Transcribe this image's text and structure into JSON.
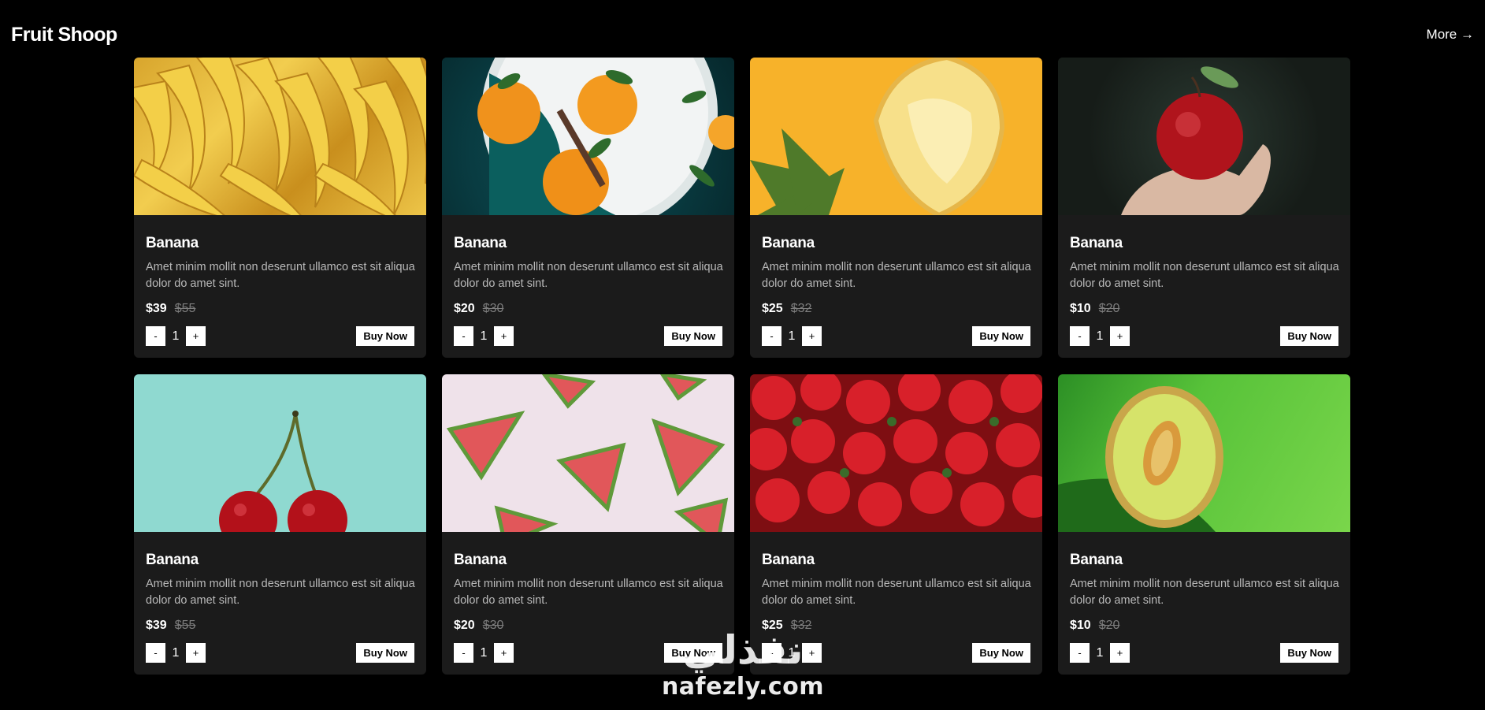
{
  "header": {
    "brand": "Fruit Shoop",
    "more_label": "More →"
  },
  "products": [
    {
      "image": "bananas",
      "title": "Banana",
      "description": "Amet minim mollit non deserunt ullamco est sit aliqua dolor do amet sint.",
      "price": "$39",
      "old_price": "$55",
      "quantity": "1",
      "minus": "-",
      "plus": "+",
      "buy_label": "Buy Now"
    },
    {
      "image": "oranges",
      "title": "Banana",
      "description": "Amet minim mollit non deserunt ullamco est sit aliqua dolor do amet sint.",
      "price": "$20",
      "old_price": "$30",
      "quantity": "1",
      "minus": "-",
      "plus": "+",
      "buy_label": "Buy Now"
    },
    {
      "image": "pineapple",
      "title": "Banana",
      "description": "Amet minim mollit non deserunt ullamco est sit aliqua dolor do amet sint.",
      "price": "$25",
      "old_price": "$32",
      "quantity": "1",
      "minus": "-",
      "plus": "+",
      "buy_label": "Buy Now"
    },
    {
      "image": "apple",
      "title": "Banana",
      "description": "Amet minim mollit non deserunt ullamco est sit aliqua dolor do amet sint.",
      "price": "$10",
      "old_price": "$20",
      "quantity": "1",
      "minus": "-",
      "plus": "+",
      "buy_label": "Buy Now"
    },
    {
      "image": "cherries",
      "title": "Banana",
      "description": "Amet minim mollit non deserunt ullamco est sit aliqua dolor do amet sint.",
      "price": "$39",
      "old_price": "$55",
      "quantity": "1",
      "minus": "-",
      "plus": "+",
      "buy_label": "Buy Now"
    },
    {
      "image": "watermelon",
      "title": "Banana",
      "description": "Amet minim mollit non deserunt ullamco est sit aliqua dolor do amet sint.",
      "price": "$20",
      "old_price": "$30",
      "quantity": "1",
      "minus": "-",
      "plus": "+",
      "buy_label": "Buy Now"
    },
    {
      "image": "strawberries",
      "title": "Banana",
      "description": "Amet minim mollit non deserunt ullamco est sit aliqua dolor do amet sint.",
      "price": "$25",
      "old_price": "$32",
      "quantity": "1",
      "minus": "-",
      "plus": "+",
      "buy_label": "Buy Now"
    },
    {
      "image": "melon",
      "title": "Banana",
      "description": "Amet minim mollit non deserunt ullamco est sit aliqua dolor do amet sint.",
      "price": "$10",
      "old_price": "$20",
      "quantity": "1",
      "minus": "-",
      "plus": "+",
      "buy_label": "Buy Now"
    }
  ],
  "watermark": {
    "arabic": "نفذلي",
    "domain": "nafezly.com"
  }
}
